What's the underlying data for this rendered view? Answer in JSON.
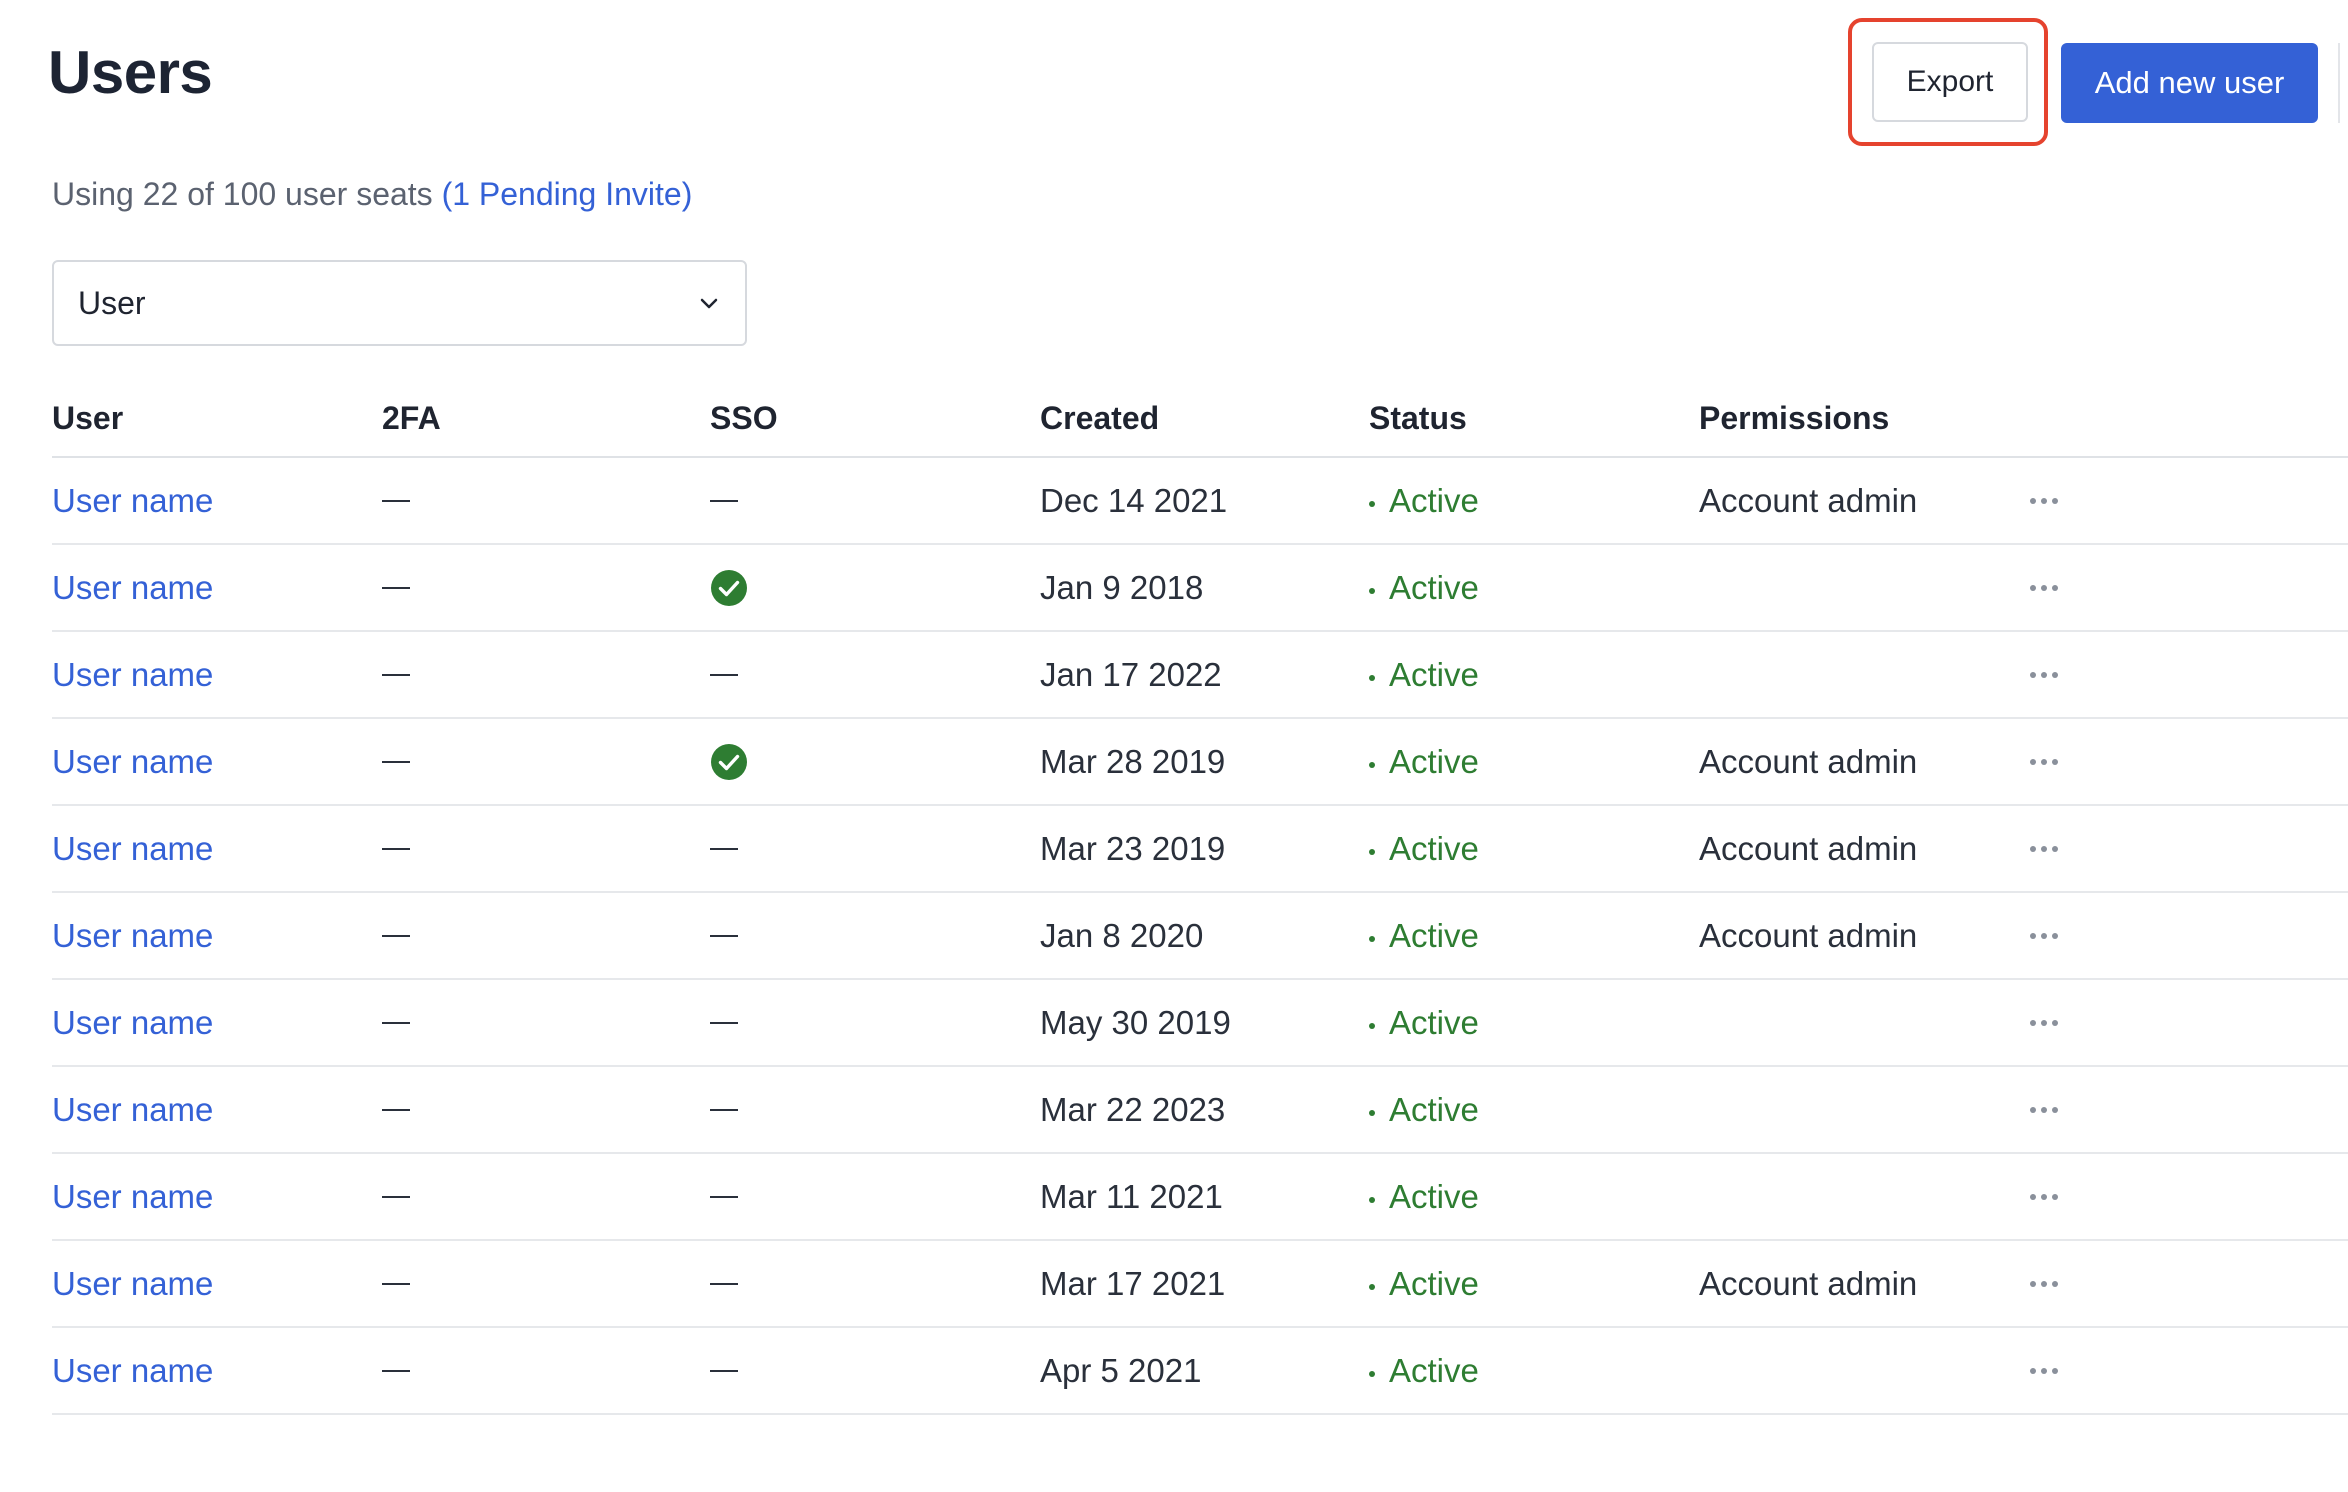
{
  "header": {
    "title": "Users",
    "export_label": "Export",
    "add_user_label": "Add new user"
  },
  "seats": {
    "text": "Using 22 of 100 user seats",
    "invite": "(1 Pending Invite)"
  },
  "filter": {
    "value": "User",
    "icon": "chevron-down-icon"
  },
  "table": {
    "columns": [
      "User",
      "2FA",
      "SSO",
      "Created",
      "Status",
      "Permissions"
    ],
    "rows": [
      {
        "user": "User name",
        "twofa": "—",
        "sso": "—",
        "created": "Dec 14 2021",
        "status": "Active",
        "permissions": "Account admin"
      },
      {
        "user": "User name",
        "twofa": "—",
        "sso": "check",
        "created": "Jan 9 2018",
        "status": "Active",
        "permissions": ""
      },
      {
        "user": "User name",
        "twofa": "—",
        "sso": "—",
        "created": "Jan 17 2022",
        "status": "Active",
        "permissions": ""
      },
      {
        "user": "User name",
        "twofa": "—",
        "sso": "check",
        "created": "Mar 28 2019",
        "status": "Active",
        "permissions": "Account admin"
      },
      {
        "user": "User name",
        "twofa": "—",
        "sso": "—",
        "created": "Mar 23 2019",
        "status": "Active",
        "permissions": "Account admin"
      },
      {
        "user": "User name",
        "twofa": "—",
        "sso": "—",
        "created": "Jan 8 2020",
        "status": "Active",
        "permissions": "Account admin"
      },
      {
        "user": "User name",
        "twofa": "—",
        "sso": "—",
        "created": "May 30 2019",
        "status": "Active",
        "permissions": ""
      },
      {
        "user": "User name",
        "twofa": "—",
        "sso": "—",
        "created": "Mar 22 2023",
        "status": "Active",
        "permissions": ""
      },
      {
        "user": "User name",
        "twofa": "—",
        "sso": "—",
        "created": "Mar 11 2021",
        "status": "Active",
        "permissions": ""
      },
      {
        "user": "User name",
        "twofa": "—",
        "sso": "—",
        "created": "Mar 17 2021",
        "status": "Active",
        "permissions": "Account admin"
      },
      {
        "user": "User name",
        "twofa": "—",
        "sso": "—",
        "created": "Apr 5 2021",
        "status": "Active",
        "permissions": ""
      }
    ]
  },
  "colors": {
    "accent": "#3461d6",
    "active": "#2e7d32",
    "highlight": "#e5432e"
  }
}
